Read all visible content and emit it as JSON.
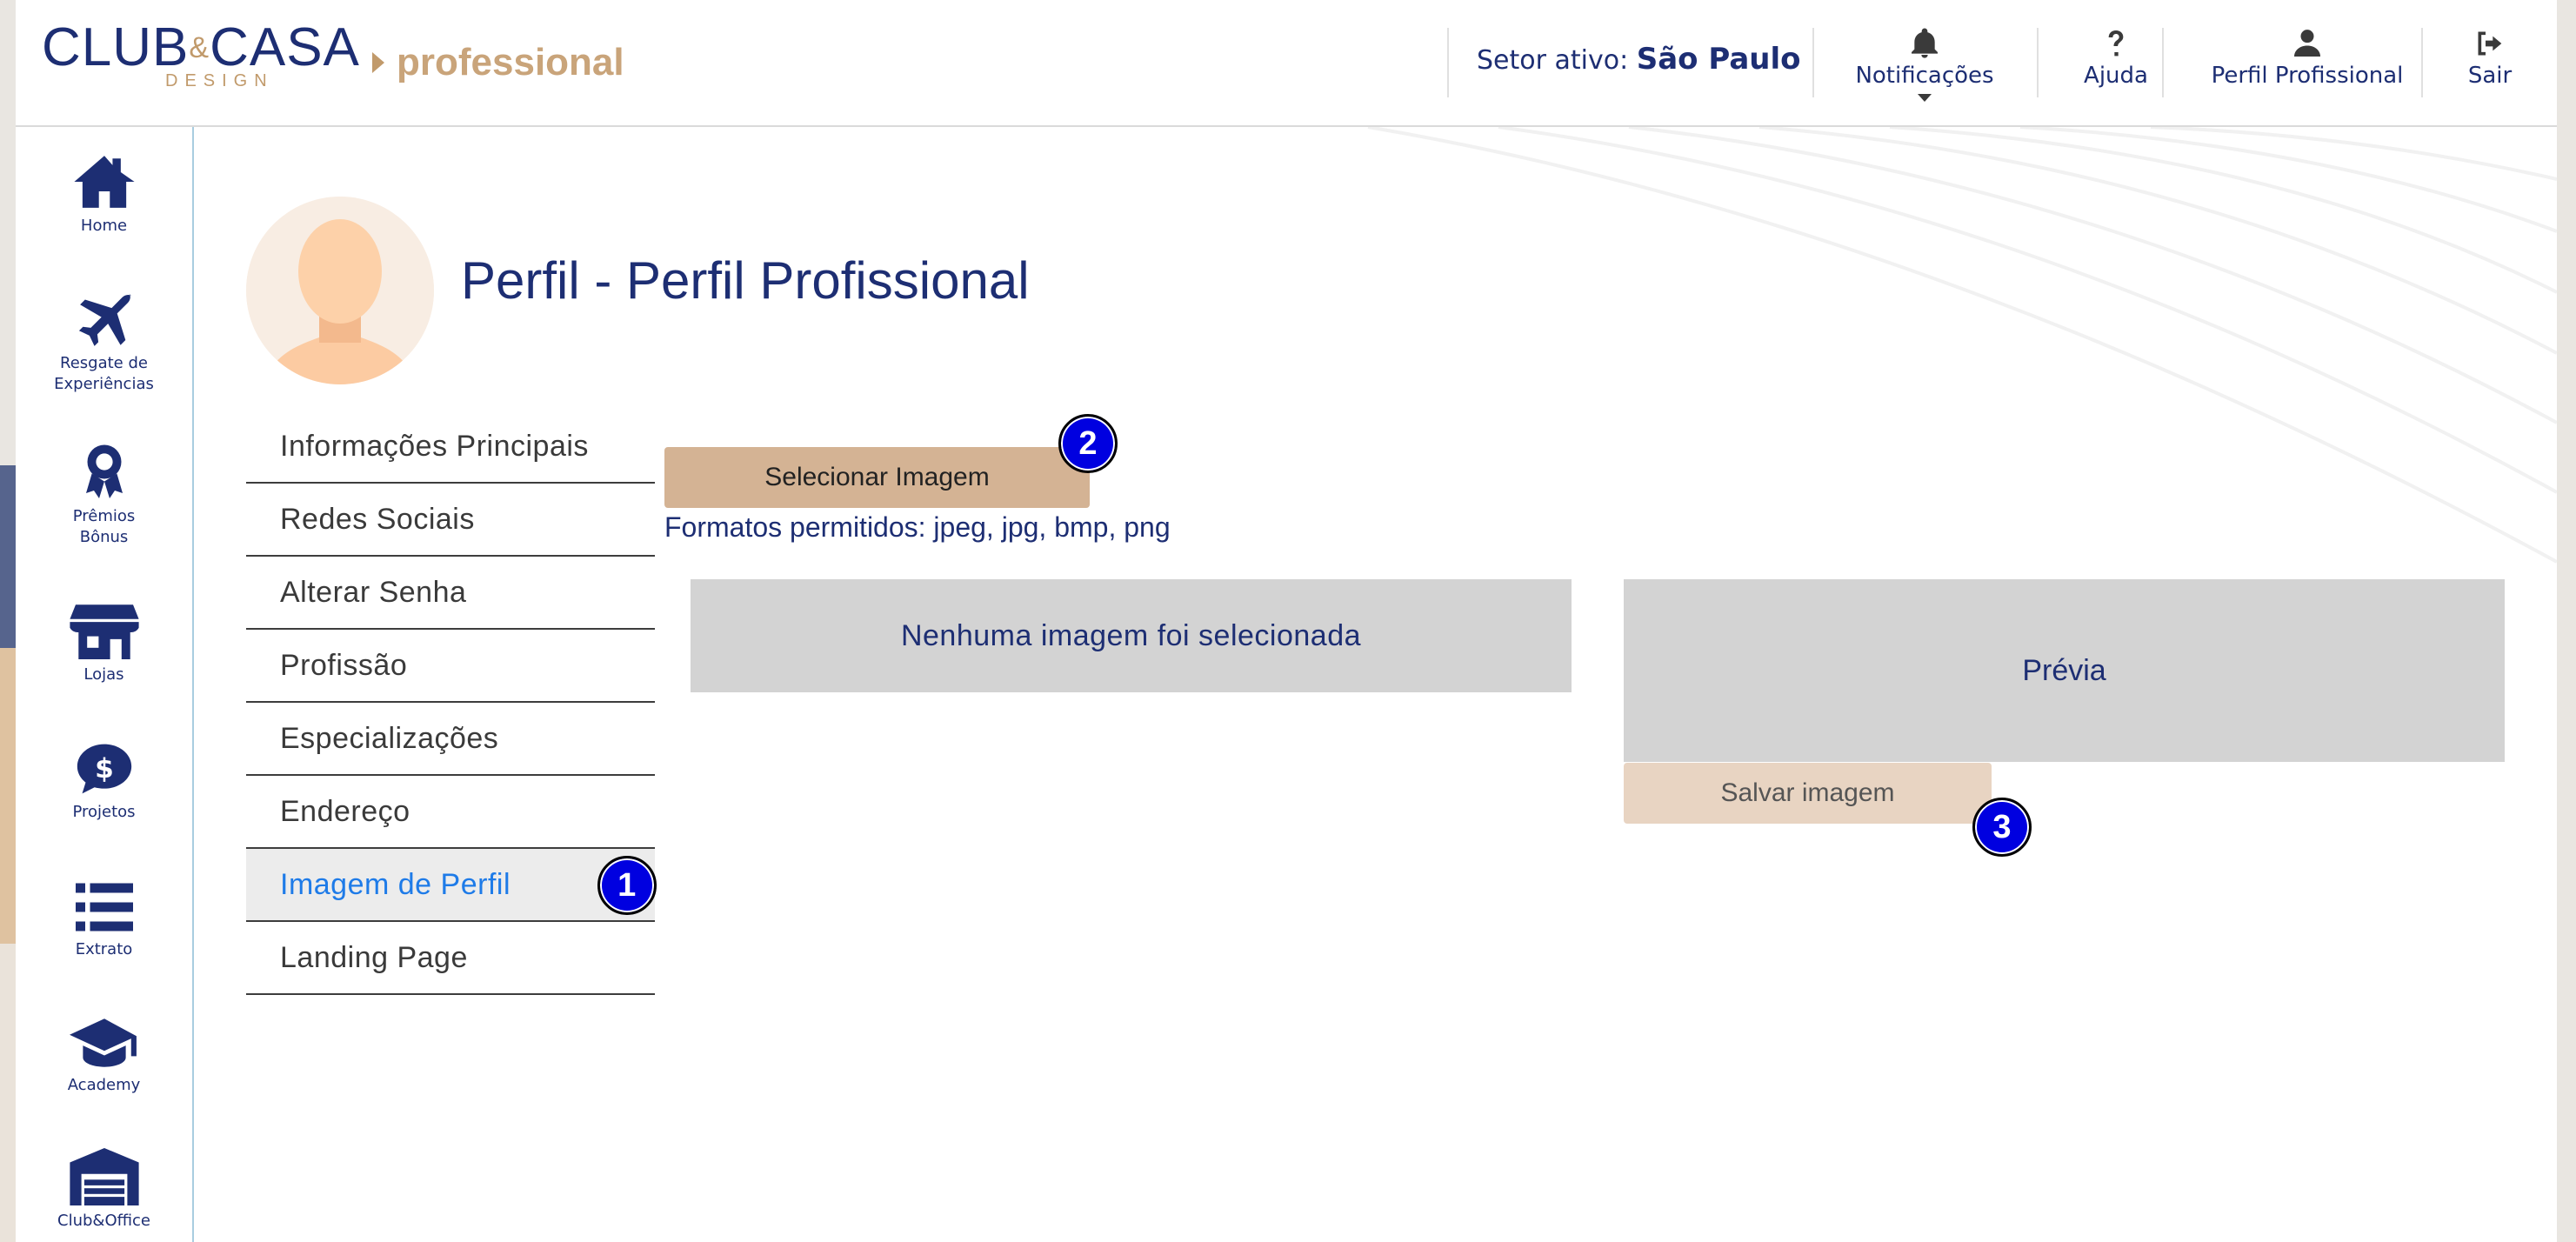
{
  "brand": {
    "logo_main": "CLUB",
    "logo_amp": "&",
    "logo_main_2": "CASA",
    "logo_sub": "DESIGN",
    "product": "professional"
  },
  "header": {
    "sector_label": "Setor ativo:",
    "sector_value": "São Paulo",
    "notifications": "Notificações",
    "help": "Ajuda",
    "profile": "Perfil Profissional",
    "logout": "Sair"
  },
  "sidebar": {
    "items": [
      {
        "label": "Home",
        "icon": "home-icon"
      },
      {
        "label_line1": "Resgate de",
        "label_line2": "Experiências",
        "icon": "airplane-icon"
      },
      {
        "label_line1": "Prêmios",
        "label_line2": "Bônus",
        "icon": "award-ribbon-icon"
      },
      {
        "label": "Lojas",
        "icon": "store-icon"
      },
      {
        "label": "Projetos",
        "icon": "dollar-chat-icon"
      },
      {
        "label": "Extrato",
        "icon": "list-icon"
      },
      {
        "label": "Academy",
        "icon": "graduation-cap-icon"
      },
      {
        "label": "Club&Office",
        "icon": "warehouse-icon"
      }
    ]
  },
  "page": {
    "title": "Perfil - Perfil Profissional"
  },
  "menu": {
    "items": [
      "Informações Principais",
      "Redes Sociais",
      "Alterar Senha",
      "Profissão",
      "Especializações",
      "Endereço",
      "Imagem de Perfil",
      "Landing Page"
    ],
    "active_index": 6
  },
  "upload": {
    "select_label": "Selecionar Imagem",
    "formats": "Formatos permitidos: jpeg, jpg, bmp, png",
    "no_image": "Nenhuma imagem foi selecionada",
    "preview": "Prévia",
    "save_label": "Salvar imagem"
  },
  "badges": [
    "1",
    "2",
    "3"
  ],
  "colors": {
    "navy": "#1d2e73",
    "gold": "#c19a6b",
    "active_blue": "#1e7be8",
    "badge_blue": "#0000e0",
    "select_btn": "#d4b394",
    "save_btn": "#e8d4c2",
    "panel_gray": "#d3d3d3"
  }
}
